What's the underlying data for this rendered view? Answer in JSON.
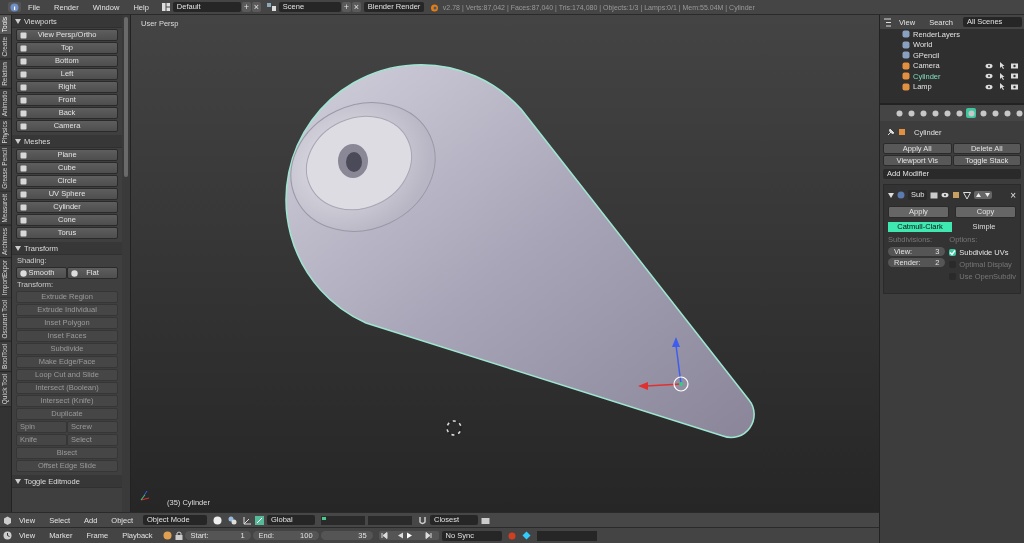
{
  "topbar": {
    "menus": [
      "File",
      "Render",
      "Window",
      "Help"
    ],
    "layout": "Default",
    "scene": "Scene",
    "engine": "Blender Render",
    "layout_buttons": [
      "+",
      "×"
    ],
    "scene_buttons": [
      "+",
      "×"
    ],
    "stats": "v2.78 | Verts:87,042 | Faces:87,040 | Tris:174,080 | Objects:1/3 | Lamps:0/1 | Mem:55.04M | Cylinder"
  },
  "tool_tabs": [
    {
      "label": "Tools",
      "selected": true
    },
    {
      "label": "Create",
      "selected": false
    },
    {
      "label": "Relation",
      "selected": false
    },
    {
      "label": "Animatio",
      "selected": false
    },
    {
      "label": "Physics",
      "selected": false
    },
    {
      "label": "Grease Pencil",
      "selected": false
    },
    {
      "label": "Measureit",
      "selected": false
    },
    {
      "label": "Archimes",
      "selected": false
    },
    {
      "label": "ImportExpor",
      "selected": false
    },
    {
      "label": "Oscurart Tool",
      "selected": false
    },
    {
      "label": "BoolTool",
      "selected": false
    },
    {
      "label": "Quick Tool",
      "selected": false
    }
  ],
  "toolshelf": {
    "panels": [
      {
        "title": "Viewports",
        "items": [
          {
            "kind": "button",
            "label": "View Persp/Ortho",
            "disabled": false
          },
          {
            "kind": "button",
            "label": "Top",
            "disabled": false
          },
          {
            "kind": "button",
            "label": "Bottom",
            "disabled": false
          },
          {
            "kind": "button",
            "label": "Left",
            "disabled": false
          },
          {
            "kind": "button",
            "label": "Right",
            "disabled": false
          },
          {
            "kind": "button",
            "label": "Front",
            "disabled": false
          },
          {
            "kind": "button",
            "label": "Back",
            "disabled": false
          },
          {
            "kind": "button",
            "label": "Camera",
            "disabled": false
          }
        ]
      },
      {
        "title": "Meshes",
        "items": [
          {
            "kind": "button",
            "label": "Plane",
            "disabled": false
          },
          {
            "kind": "button",
            "label": "Cube",
            "disabled": false
          },
          {
            "kind": "button",
            "label": "Circle",
            "disabled": false
          },
          {
            "kind": "button",
            "label": "UV Sphere",
            "disabled": false
          },
          {
            "kind": "button",
            "label": "Cylinder",
            "disabled": false
          },
          {
            "kind": "button",
            "label": "Cone",
            "disabled": false
          },
          {
            "kind": "button",
            "label": "Torus",
            "disabled": false
          }
        ]
      },
      {
        "title": "Transform",
        "items": [
          {
            "kind": "label",
            "label": "Shading:"
          },
          {
            "kind": "pair",
            "buttons": [
              {
                "label": "Smooth",
                "disabled": false
              },
              {
                "label": "Flat",
                "disabled": false
              }
            ]
          },
          {
            "kind": "label",
            "label": "Transform:"
          },
          {
            "kind": "button",
            "label": "Extrude Region",
            "disabled": true
          },
          {
            "kind": "button",
            "label": "Extrude Individual",
            "disabled": true
          },
          {
            "kind": "button",
            "label": "Inset Polygon",
            "disabled": true
          },
          {
            "kind": "button",
            "label": "Inset Faces",
            "disabled": true
          },
          {
            "kind": "button",
            "label": "Subdivide",
            "disabled": true
          },
          {
            "kind": "button",
            "label": "Make Edge/Face",
            "disabled": true
          },
          {
            "kind": "button",
            "label": "Loop Cut and Slide",
            "disabled": true
          },
          {
            "kind": "button",
            "label": "Intersect (Boolean)",
            "disabled": true
          },
          {
            "kind": "button",
            "label": "Intersect (Knife)",
            "disabled": true
          },
          {
            "kind": "button",
            "label": "Duplicate",
            "disabled": true
          },
          {
            "kind": "pair",
            "buttons": [
              {
                "label": "Spin",
                "disabled": true
              },
              {
                "label": "Screw",
                "disabled": true
              }
            ]
          },
          {
            "kind": "pair",
            "buttons": [
              {
                "label": "Knife",
                "disabled": true
              },
              {
                "label": "Select",
                "disabled": true
              }
            ]
          },
          {
            "kind": "button",
            "label": "Bisect",
            "disabled": true
          },
          {
            "kind": "button",
            "label": "Offset Edge Slide",
            "disabled": true
          }
        ]
      },
      {
        "title": "Toggle Editmode"
      }
    ]
  },
  "viewport": {
    "title": "User Persp",
    "object_label": "(35) Cylinder"
  },
  "outliner": {
    "menus": [
      "View",
      "Search"
    ],
    "filter": "All Scenes",
    "items": [
      {
        "label": "RenderLayers",
        "kind": "data",
        "selected": false
      },
      {
        "label": "World",
        "kind": "data",
        "selected": false
      },
      {
        "label": "GPencil",
        "kind": "data",
        "selected": false
      },
      {
        "label": "Camera",
        "kind": "object",
        "selected": false
      },
      {
        "label": "Cylinder",
        "kind": "object",
        "selected": true
      },
      {
        "label": "Lamp",
        "kind": "object",
        "selected": false
      }
    ]
  },
  "properties": {
    "tabs": [
      {
        "selected": false
      },
      {
        "selected": false
      },
      {
        "selected": false
      },
      {
        "selected": false
      },
      {
        "selected": false
      },
      {
        "selected": false
      },
      {
        "selected": true
      },
      {
        "selected": false
      },
      {
        "selected": false
      },
      {
        "selected": false
      },
      {
        "selected": false
      }
    ],
    "context": "Cylinder",
    "buttons": [
      "Apply All",
      "Delete All",
      "Viewport Vis",
      "Toggle Stack"
    ],
    "add_modifier": "Add Modifier",
    "modifier": {
      "name": "Sub",
      "close": "×",
      "actions": [
        "Apply",
        "Copy"
      ],
      "types": [
        {
          "label": "Catmull-Clark",
          "selected": true
        },
        {
          "label": "Simple",
          "selected": false
        }
      ],
      "subdivisions_label": "Subdivisions:",
      "options_label": "Options:",
      "fields": [
        {
          "label": "View:",
          "value": "3"
        },
        {
          "label": "Render:",
          "value": "2"
        }
      ],
      "options": [
        {
          "label": "Subdivide UVs",
          "checked": true,
          "disabled": false
        },
        {
          "label": "Optimal Display",
          "checked": false,
          "disabled": true
        },
        {
          "label": "Use OpenSubdiv",
          "checked": false,
          "disabled": true
        }
      ]
    }
  },
  "view3d_header": {
    "menus": [
      "View",
      "Select",
      "Add",
      "Object"
    ],
    "mode": "Object Mode",
    "orientation": "Global",
    "snap": "Closest"
  },
  "timeline": {
    "menus": [
      "View",
      "Marker",
      "Frame",
      "Playback"
    ],
    "start_label": "Start:",
    "start": "1",
    "end_label": "End:",
    "end": "100",
    "frame": "35",
    "sync": "No Sync"
  }
}
